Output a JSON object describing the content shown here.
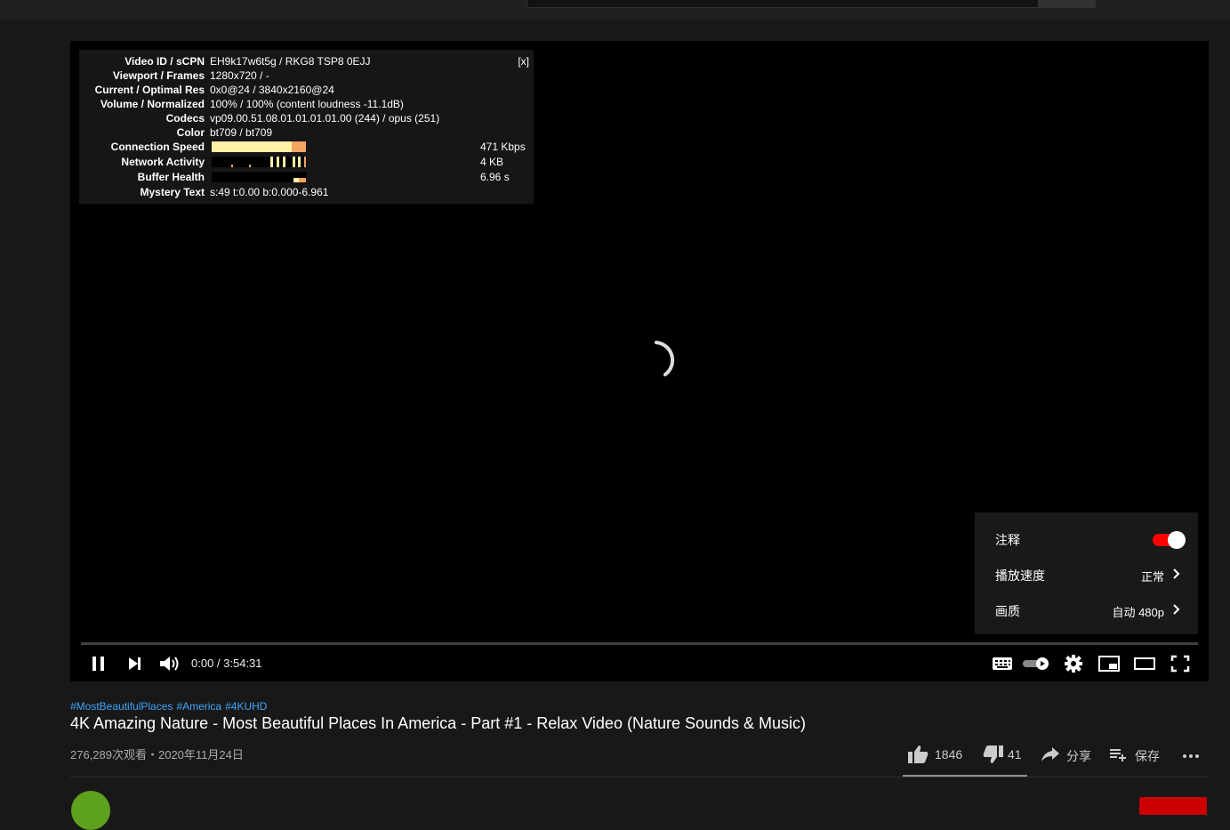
{
  "stats": {
    "close_label": "[x]",
    "rows": [
      {
        "label": "Video ID / sCPN",
        "value": "EH9k17w6t5g / RKG8 TSP8 0EJJ"
      },
      {
        "label": "Viewport / Frames",
        "value": "1280x720 / -"
      },
      {
        "label": "Current / Optimal Res",
        "value": "0x0@24 / 3840x2160@24"
      },
      {
        "label": "Volume / Normalized",
        "value": "100% / 100% (content loudness -11.1dB)"
      },
      {
        "label": "Codecs",
        "value": "vp09.00.51.08.01.01.01.01.00 (244) / opus (251)"
      },
      {
        "label": "Color",
        "value": "bt709 / bt709"
      }
    ],
    "bars": [
      {
        "label": "Connection Speed",
        "value": "471 Kbps"
      },
      {
        "label": "Network Activity",
        "value": "4 KB"
      },
      {
        "label": "Buffer Health",
        "value": "6.96 s"
      }
    ],
    "mystery": {
      "label": "Mystery Text",
      "value": "s:49 t:0.00 b:0.000-6.961"
    }
  },
  "settings_menu": {
    "annotations_label": "注释",
    "annotations_on": true,
    "speed_label": "播放速度",
    "speed_value": "正常",
    "quality_label": "画质",
    "quality_value": "自动 480p"
  },
  "controls": {
    "time": "0:00 / 3:54:31",
    "progress": 0
  },
  "video": {
    "hashtags": [
      "#MostBeautifulPlaces",
      "#America",
      "#4KUHD"
    ],
    "title": "4K Amazing Nature - Most Beautiful Places In America - Part #1 - Relax Video (Nature Sounds & Music)",
    "views_date": "276,289次观看・2020年11月24日",
    "likes": "1846",
    "dislikes": "41",
    "share_label": "分享",
    "save_label": "保存"
  },
  "colors": {
    "accent_red": "#ff0000",
    "link_blue": "#3ea6ff",
    "bar_yellow": "#fff2a6",
    "bar_orange": "#f4a460"
  }
}
